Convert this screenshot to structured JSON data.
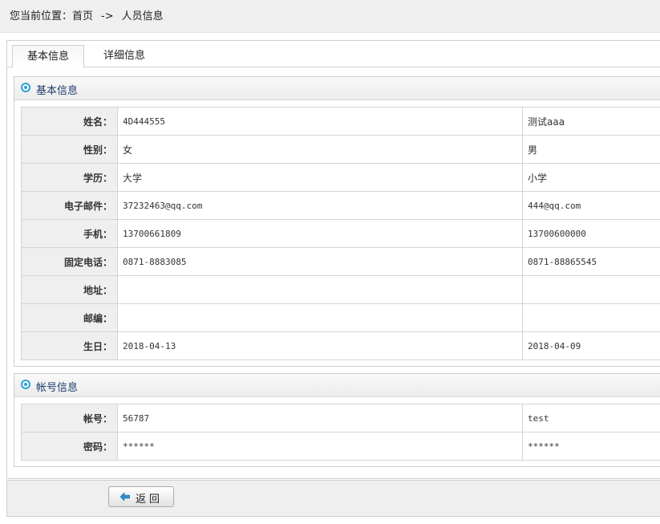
{
  "breadcrumb": {
    "prefix": "您当前位置：",
    "home": "首页",
    "separator": "->",
    "current": "人员信息"
  },
  "tabs": [
    {
      "label": "基本信息",
      "active": true
    },
    {
      "label": "详细信息",
      "active": false
    }
  ],
  "basic_panel": {
    "title": "基本信息",
    "rows": [
      {
        "label": "姓名：",
        "value1": "4D444555",
        "value2": "测试aaa"
      },
      {
        "label": "性别：",
        "value1": "女",
        "value2": "男"
      },
      {
        "label": "学历：",
        "value1": "大学",
        "value2": "小学"
      },
      {
        "label": "电子邮件：",
        "value1": "37232463@qq.com",
        "value2": "444@qq.com"
      },
      {
        "label": "手机：",
        "value1": "13700661809",
        "value2": "13700600000"
      },
      {
        "label": "固定电话：",
        "value1": "0871-8883085",
        "value2": "0871-88865545"
      },
      {
        "label": "地址：",
        "value1": "",
        "value2": ""
      },
      {
        "label": "邮编：",
        "value1": "",
        "value2": ""
      },
      {
        "label": "生日：",
        "value1": "2018-04-13",
        "value2": "2018-04-09"
      }
    ]
  },
  "account_panel": {
    "title": "帐号信息",
    "rows": [
      {
        "label": "帐号：",
        "value1": "56787",
        "value2": "test"
      },
      {
        "label": "密码：",
        "value1": "******",
        "value2": "******"
      }
    ]
  },
  "footer": {
    "back_label": "返回",
    "back_icon": "arrow-left-icon"
  },
  "colors": {
    "accent": "#2aa3d6",
    "panel_title": "#1e3d6b",
    "label_bg": "#efefef"
  }
}
